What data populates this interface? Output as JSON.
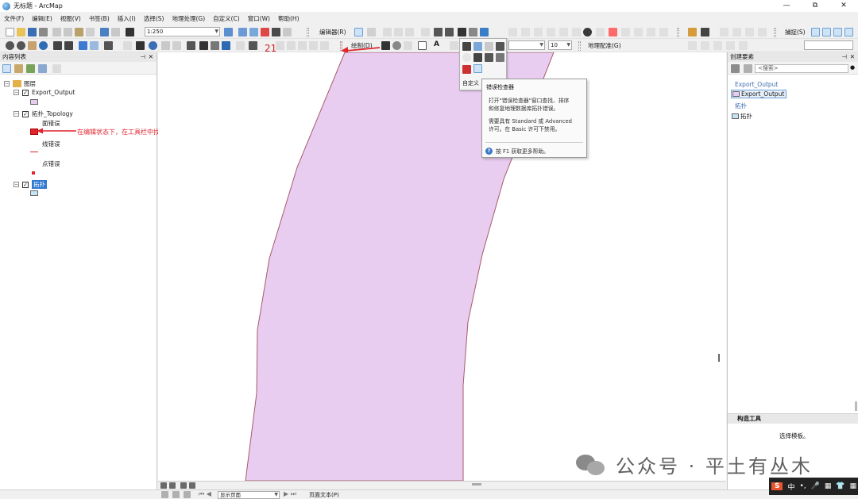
{
  "window": {
    "title": "无标题 - ArcMap",
    "controls": [
      "—",
      "⧉",
      "✕"
    ]
  },
  "menu": [
    "文件(F)",
    "编辑(E)",
    "视图(V)",
    "书签(B)",
    "插入(I)",
    "选择(S)",
    "地理处理(G)",
    "自定义(C)",
    "窗口(W)",
    "帮助(H)"
  ],
  "toolbar": {
    "scale": "1:250",
    "editor_label": "编辑器(R)",
    "snapping_label": "捕捉(S)",
    "draw_label": "绘制(D)",
    "font_size": "10",
    "georef_label": "地理配准(G)",
    "customize_label": "自定义",
    "step_number": "21"
  },
  "toc": {
    "title": "内容列表",
    "root": "图层",
    "layers": [
      {
        "name": "Export_Output",
        "checked": true
      },
      {
        "name": "拓扑_Topology",
        "checked": true,
        "children": [
          "面错误",
          "线错误",
          "点错误"
        ]
      },
      {
        "name": "拓扑",
        "checked": true,
        "selected": true
      }
    ]
  },
  "annotation": "在编辑状态下，在工具栏中找到错误检查器",
  "tooltip": {
    "title": "错误检查器",
    "body_lines": [
      "打开\"错误检查器\"窗口查找、排序",
      "和修复地理数据库拓扑错误。",
      "",
      "需要具有 Standard 或 Advanced",
      "许可。在 Basic 许可下禁用。"
    ],
    "help": "按 F1 获取更多帮助。"
  },
  "create_features": {
    "title": "创建要素",
    "search_placeholder": "<搜索>",
    "groups": [
      {
        "name": "Export_Output",
        "items": [
          "Export_Output"
        ]
      },
      {
        "name": "拓扑",
        "items": [
          "拓扑"
        ]
      }
    ]
  },
  "construction_tools": {
    "title": "构造工具",
    "message": "选择模板。"
  },
  "status": {
    "page_label": "显示页面",
    "text_label": "页面文本(P)"
  },
  "watermark": "公众号 · 平土有丛木",
  "ime": [
    "S",
    "中",
    "•,",
    "🎤",
    "▦",
    "👕",
    "▦"
  ],
  "colors": {
    "polygon_fill": "#e8cdf0",
    "polygon_stroke": "#a85a6a",
    "annotation": "#e0242e",
    "topology_swatch": "#c6e4f6"
  }
}
